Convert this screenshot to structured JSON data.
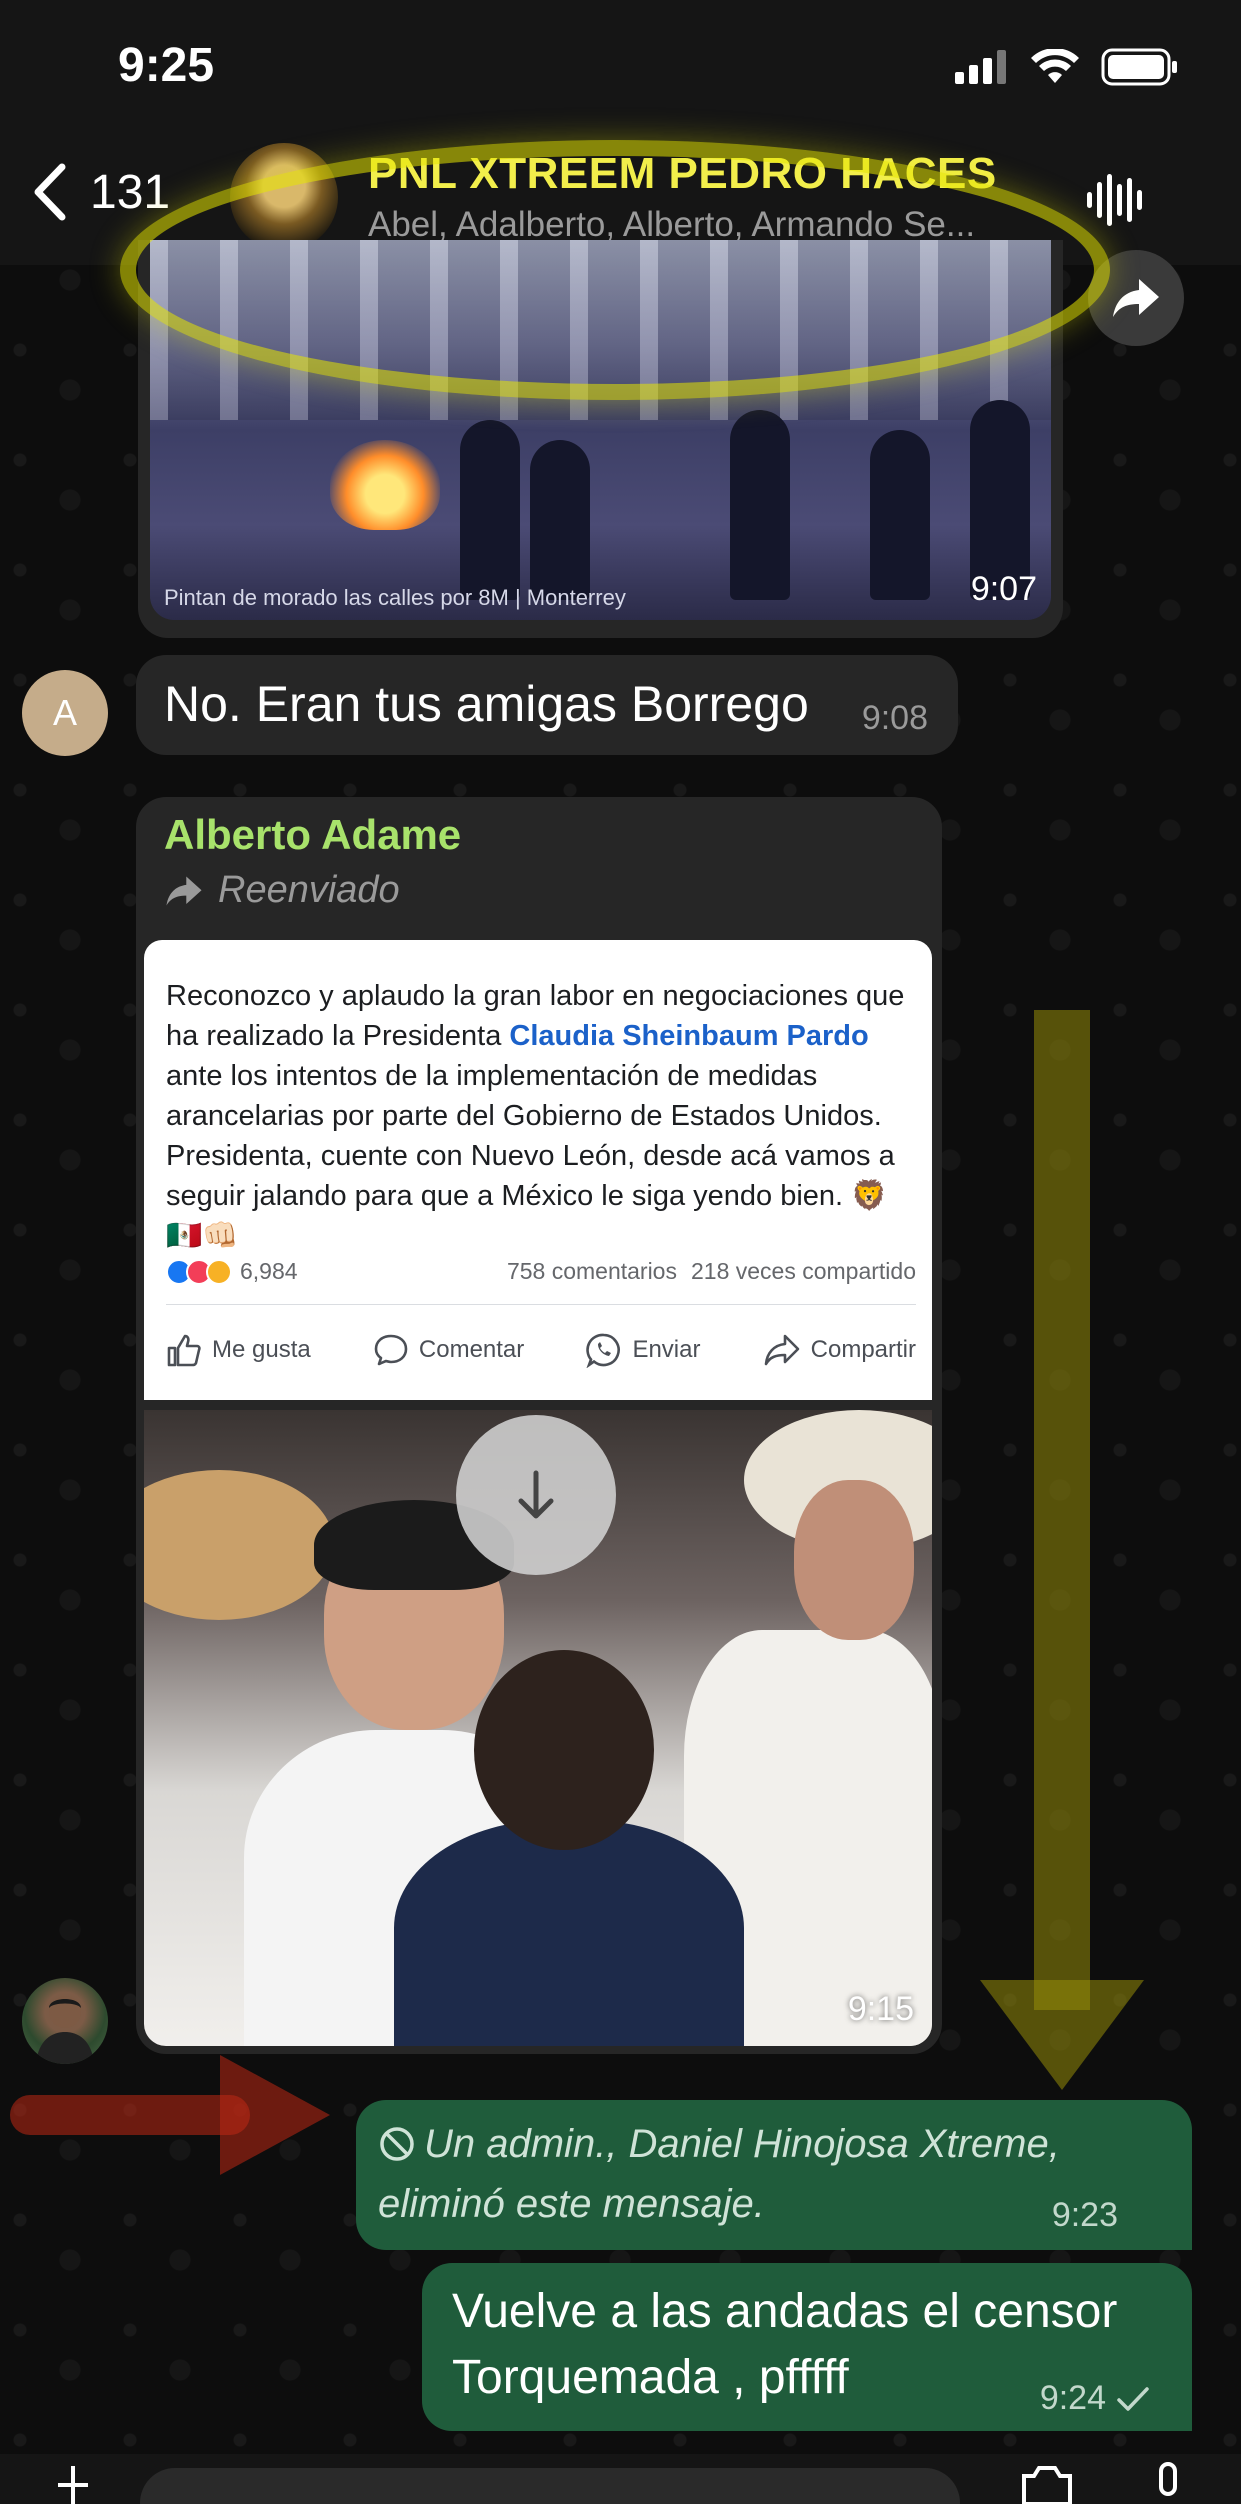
{
  "status_bar": {
    "time": "9:25"
  },
  "header": {
    "back_count": "131",
    "title": "PNL XTREEM PEDRO HACES",
    "subtitle": "Abel, Adalberto, Alberto, Armando Se..."
  },
  "messages": {
    "video": {
      "caption": "Pintan de morado las calles por 8M | Monterrey",
      "time": "9:07"
    },
    "text_in": {
      "avatar_letter": "A",
      "text": "No. Eran tus amigas Borrego",
      "time": "9:08"
    },
    "forwarded": {
      "sender": "Alberto Adame",
      "forward_label": "Reenviado",
      "post": {
        "text_before": "Reconozco y aplaudo la gran labor en negociaciones que ha realizado la Presidenta ",
        "mention": "Claudia Sheinbaum Pardo",
        "text_after": " ante los intentos de la implementación de medidas arancelarias por parte del Gobierno de Estados Unidos. Presidenta, cuente con Nuevo León, desde acá vamos a seguir jalando para que a México le siga yendo bien. 🦁🇲🇽👊🏻",
        "reactions_count": "6,984",
        "comments": "758 comentarios",
        "shares": "218 veces compartido",
        "actions": {
          "like": "Me gusta",
          "comment": "Comentar",
          "send": "Enviar",
          "share": "Compartir"
        }
      },
      "time": "9:15"
    },
    "deleted_out": {
      "text": "Un admin., Daniel Hinojosa Xtreme, eliminó este mensaje.",
      "time": "9:23"
    },
    "text_out": {
      "text": "Vuelve a las andadas el censor Torquemada , pfffff",
      "time": "9:24"
    }
  },
  "colors": {
    "title_yellow": "#f2ee4b",
    "sender_green": "#a8e26b",
    "outgoing_bubble": "#1f5c3b",
    "incoming_bubble": "#262626",
    "mention_blue": "#1b61c9"
  },
  "icons": {
    "back": "chevron-left-icon",
    "voice": "waveform-icon",
    "share": "forward-arrow-icon",
    "forward": "forward-arrow-icon",
    "download": "arrow-down-icon",
    "deleted": "no-entry-icon",
    "read": "checkmark-icon"
  }
}
